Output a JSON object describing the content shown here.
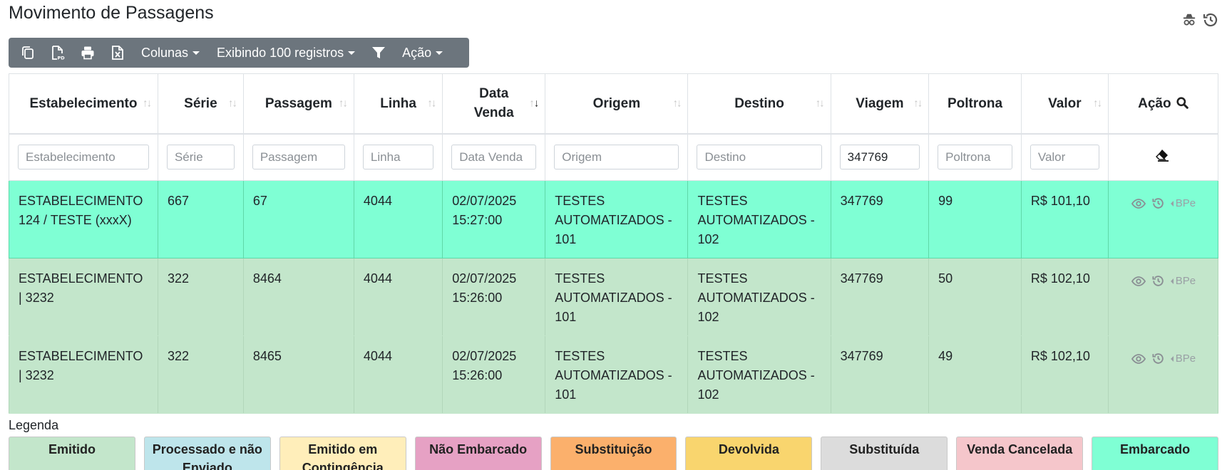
{
  "page": {
    "title": "Movimento de Passagens"
  },
  "top_icons": [
    "incognito-icon",
    "history-icon"
  ],
  "toolbar": {
    "icons": [
      "copy-icon",
      "pdf-icon",
      "print-icon",
      "excel-icon"
    ],
    "colunas_label": "Colunas",
    "exibindo_label": "Exibindo 100 registros",
    "filter_icon": "filter-icon",
    "acao_label": "Ação"
  },
  "table": {
    "headers": [
      "Estabelecimento",
      "Série",
      "Passagem",
      "Linha",
      "Data Venda",
      "Origem",
      "Destino",
      "Viagem",
      "Poltrona",
      "Valor",
      "Ação"
    ],
    "filters": {
      "estabelecimento": {
        "placeholder": "Estabelecimento",
        "value": ""
      },
      "serie": {
        "placeholder": "Série",
        "value": ""
      },
      "passagem": {
        "placeholder": "Passagem",
        "value": ""
      },
      "linha": {
        "placeholder": "Linha",
        "value": ""
      },
      "data_venda": {
        "placeholder": "Data Venda",
        "value": ""
      },
      "origem": {
        "placeholder": "Origem",
        "value": ""
      },
      "destino": {
        "placeholder": "Destino",
        "value": ""
      },
      "viagem": {
        "placeholder": "Viagem",
        "value": "347769"
      },
      "poltrona": {
        "placeholder": "Poltrona",
        "value": ""
      },
      "valor": {
        "placeholder": "Valor",
        "value": ""
      }
    },
    "rows": [
      {
        "status": "Embarcado",
        "estabelecimento": "ESTABELECIMENTO 124 / TESTE (xxxX)",
        "serie": "667",
        "passagem": "67",
        "linha": "4044",
        "data_venda": "02/07/2025 15:27:00",
        "origem": "TESTES AUTOMATIZADOS - 101",
        "destino": "TESTES AUTOMATIZADOS - 102",
        "viagem": "347769",
        "poltrona": "99",
        "valor": "R$ 101,10",
        "bpe": "BPe"
      },
      {
        "status": "Emitido",
        "estabelecimento": "ESTABELECIMENTO | 3232",
        "serie": "322",
        "passagem": "8464",
        "linha": "4044",
        "data_venda": "02/07/2025 15:26:00",
        "origem": "TESTES AUTOMATIZADOS - 101",
        "destino": "TESTES AUTOMATIZADOS - 102",
        "viagem": "347769",
        "poltrona": "50",
        "valor": "R$ 102,10",
        "bpe": "BPe"
      },
      {
        "status": "Emitido",
        "estabelecimento": "ESTABELECIMENTO | 3232",
        "serie": "322",
        "passagem": "8465",
        "linha": "4044",
        "data_venda": "02/07/2025 15:26:00",
        "origem": "TESTES AUTOMATIZADOS - 101",
        "destino": "TESTES AUTOMATIZADOS - 102",
        "viagem": "347769",
        "poltrona": "49",
        "valor": "R$ 102,10",
        "bpe": "BPe"
      }
    ]
  },
  "legend": {
    "title": "Legenda",
    "items": [
      {
        "label": "Emitido",
        "color": "#c3e6cb"
      },
      {
        "label": "Processado e não Enviado",
        "color": "#bee5eb"
      },
      {
        "label": "Emitido em Contingência",
        "color": "#ffeeba"
      },
      {
        "label": "Não Embarcado",
        "color": "#e6a1c4"
      },
      {
        "label": "Substituição",
        "color": "#fbb06c"
      },
      {
        "label": "Devolvida",
        "color": "#f9d56e"
      },
      {
        "label": "Substituída",
        "color": "#dcdcdc"
      },
      {
        "label": "Venda Cancelada",
        "color": "#f5c6cb"
      },
      {
        "label": "Embarcado",
        "color": "#7fffd4"
      }
    ]
  }
}
